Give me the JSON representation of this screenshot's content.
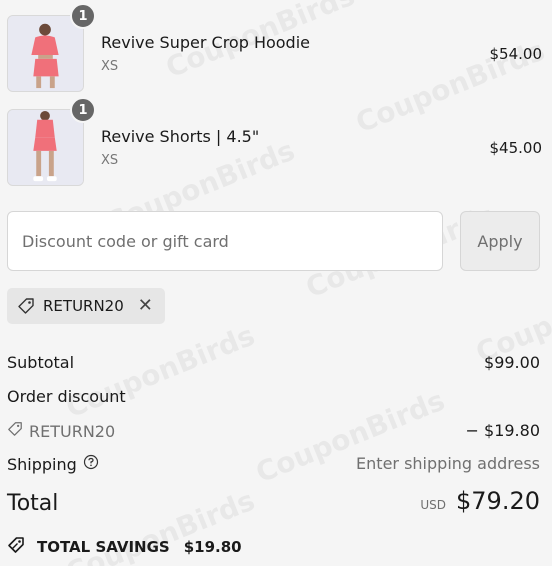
{
  "items": [
    {
      "name": "Revive Super Crop Hoodie",
      "variant": "XS",
      "price": "$54.00",
      "qty": "1"
    },
    {
      "name": "Revive Shorts | 4.5\"",
      "variant": "XS",
      "price": "$45.00",
      "qty": "1"
    }
  ],
  "discount": {
    "placeholder": "Discount code or gift card",
    "apply_label": "Apply",
    "applied_code": "RETURN20"
  },
  "summary": {
    "subtotal_label": "Subtotal",
    "subtotal_value": "$99.00",
    "order_discount_label": "Order discount",
    "discount_code": "RETURN20",
    "discount_value": "− $19.80",
    "shipping_label": "Shipping",
    "shipping_value": "Enter shipping address",
    "total_label": "Total",
    "total_currency": "USD",
    "total_value": "$79.20"
  },
  "savings": {
    "label": "TOTAL SAVINGS",
    "value": "$19.80"
  },
  "watermark": "CouponBirds",
  "colors": {
    "background": "#f5f5f5",
    "badge": "#666666",
    "product": "#f0707a"
  }
}
